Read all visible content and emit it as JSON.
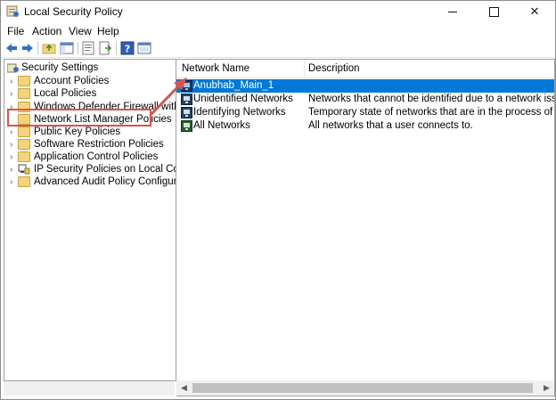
{
  "window": {
    "title": "Local Security Policy",
    "controls": {
      "minimize": "minimize",
      "maximize": "maximize",
      "close": "✕"
    }
  },
  "menu": [
    "File",
    "Action",
    "View",
    "Help"
  ],
  "toolbar": {
    "icons": [
      "back-arrow-icon",
      "forward-arrow-icon",
      "up-folder-icon",
      "show-hide-tree-icon",
      "properties-icon",
      "export-list-icon",
      "help-icon",
      "console-icon"
    ]
  },
  "tree": {
    "root": "Security Settings",
    "items": [
      {
        "label": "Account Policies",
        "expander": "›"
      },
      {
        "label": "Local Policies",
        "expander": "›"
      },
      {
        "label": "Windows Defender Firewall with Adva",
        "expander": "›"
      },
      {
        "label": "Network List Manager Policies",
        "expander": ""
      },
      {
        "label": "Public Key Policies",
        "expander": "›"
      },
      {
        "label": "Software Restriction Policies",
        "expander": "›"
      },
      {
        "label": "Application Control Policies",
        "expander": "›"
      },
      {
        "label": "IP Security Policies on Local Compute",
        "expander": "›"
      },
      {
        "label": "Advanced Audit Policy Configuration",
        "expander": "›"
      }
    ],
    "highlighted_item": "Network List Manager Policies"
  },
  "list": {
    "columns": [
      "Network Name",
      "Description"
    ],
    "rows": [
      {
        "name": "Anubhab_Main_1",
        "description": "",
        "selected": true
      },
      {
        "name": "Unidentified Networks",
        "description": "Networks that cannot be identified due to a network issue or lack o",
        "selected": false
      },
      {
        "name": "Identifying Networks",
        "description": "Temporary state of networks that are in the process of being ident",
        "selected": false
      },
      {
        "name": "All Networks",
        "description": "All networks that a user connects to.",
        "selected": false
      }
    ]
  },
  "colors": {
    "selection": "#0078d7",
    "annotation": "#d9534f",
    "folder": "#f3d47c"
  }
}
